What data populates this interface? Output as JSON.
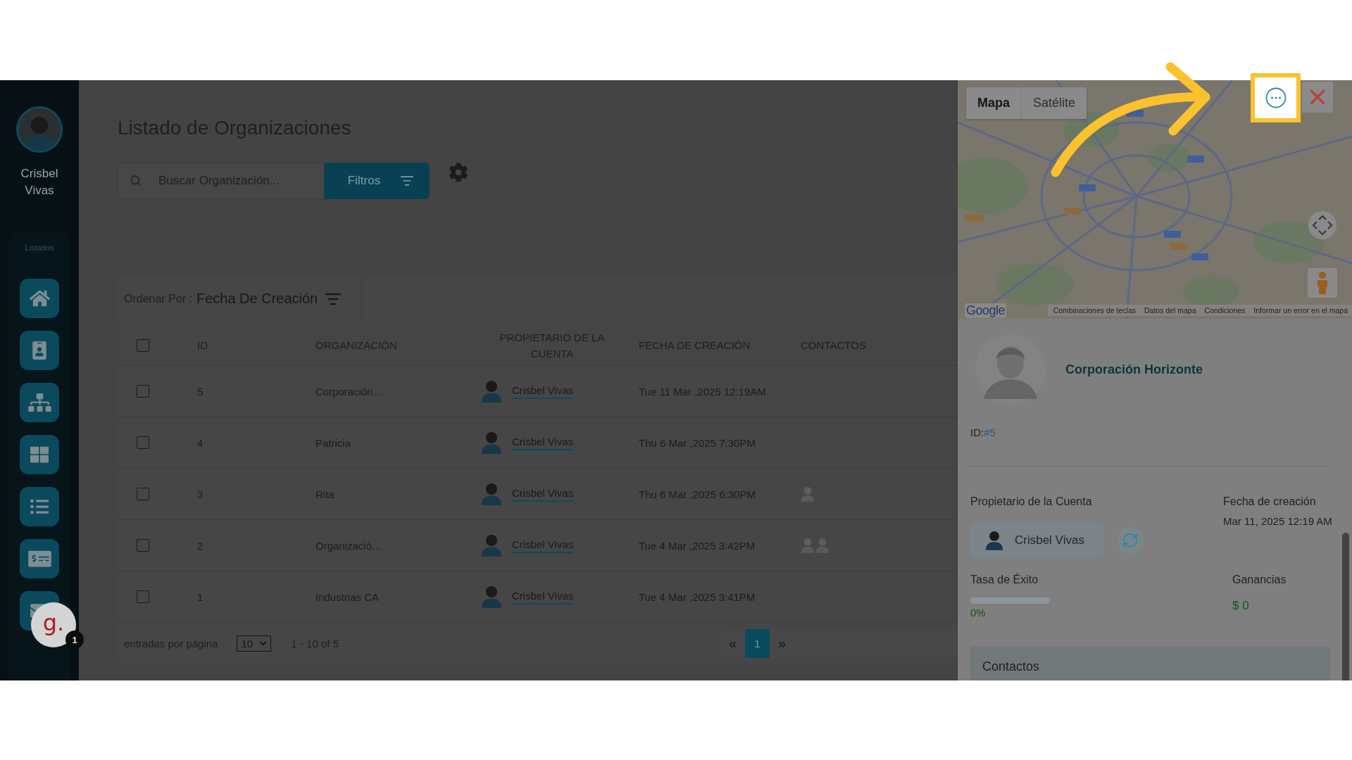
{
  "sidebar": {
    "user_name": "Crisbel Vivas",
    "section_label": "Listados"
  },
  "help_widget": {
    "label": "g.",
    "badge": "1"
  },
  "page": {
    "title": "Listado de Organizaciones",
    "search": {
      "placeholder": "Buscar Organización..."
    },
    "filter_button": "Filtros"
  },
  "sort": {
    "label": "Ordenar Por :",
    "value": "Fecha De Creación"
  },
  "table": {
    "select_all": {
      "checked": false
    },
    "columns": [
      "ID",
      "ORGANIZACIÓN",
      "PROPIETARIO DE LA CUENTA",
      "FECHA DE CREACIÓN",
      "CONTACTOS"
    ],
    "rows": [
      {
        "checked": false,
        "id": "5",
        "organization": "Corporación…",
        "owner": "Crisbel Vivas",
        "created": "Tue 11 Mar ,2025 12:19AM"
      },
      {
        "checked": false,
        "id": "4",
        "organization": "Patricia",
        "owner": "Crisbel Vivas",
        "created": "Thu 6 Mar ,2025 7:30PM"
      },
      {
        "checked": false,
        "id": "3",
        "organization": "Rita",
        "owner": "Crisbel Vivas",
        "created": "Thu 6 Mar ,2025 6:30PM",
        "contacts": [
          {
            "has_photo": false
          }
        ]
      },
      {
        "checked": false,
        "id": "2",
        "organization": "Organizació…",
        "owner": "Crisbel Vivas",
        "created": "Tue 4 Mar ,2025 3:42PM",
        "contacts": [
          {
            "has_photo": false
          },
          {
            "has_photo": false
          }
        ]
      },
      {
        "checked": false,
        "id": "1",
        "organization": "Industrias CA",
        "owner": "Crisbel Vivas",
        "created": "Tue 4 Mar ,2025 3:41PM"
      }
    ]
  },
  "pagination": {
    "per_page_label": "entradas por página",
    "per_page": "10",
    "range": "1 - 10 of 5",
    "prev": "«",
    "pages": [
      {
        "label": "1",
        "selected": true
      }
    ],
    "next": "»"
  },
  "detail_panel": {
    "map": {
      "tabs": [
        {
          "label": "Mapa",
          "selected": true
        },
        {
          "label": "Satélite",
          "selected": false
        }
      ],
      "logo": "Google",
      "links": [
        "Combinaciones de teclas",
        "Datos del mapa",
        "Condiciones",
        "Informar un error en el mapa"
      ]
    },
    "more_button": {
      "highlighted": true
    },
    "organization": {
      "name": "Corporación Horizonte",
      "id_label": "ID:",
      "id": "#5"
    },
    "owner": {
      "label": "Propietario de la Cuenta",
      "name": "Crisbel Vivas"
    },
    "created": {
      "label": "Fecha de creación",
      "value": "Mar 11, 2025 12:19 AM"
    },
    "success_rate": {
      "label": "Tasa de Éxito",
      "level": 0,
      "reading": "0%"
    },
    "earnings": {
      "label": "Ganancias",
      "value": "$ 0"
    },
    "contacts": {
      "title": "Contactos"
    }
  }
}
